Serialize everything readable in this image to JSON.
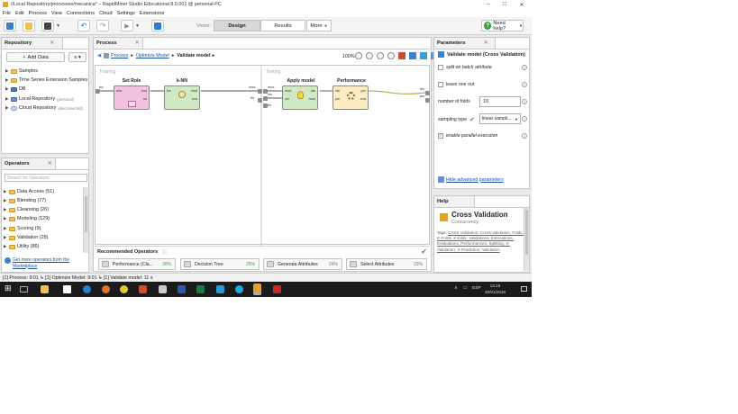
{
  "window": {
    "title": "//Local Repository/processes/mecanica* – RapidMiner Studio Educational 8.0.001 @ personal-PC",
    "min": "–",
    "max": "□",
    "close": "✕"
  },
  "menu": [
    "File",
    "Edit",
    "Process",
    "View",
    "Connections",
    "Cloud",
    "Settings",
    "Extensions"
  ],
  "toolbar": {
    "views_label": "Views:",
    "views": [
      "Design",
      "Results",
      "More"
    ],
    "help": "Need help?"
  },
  "repository": {
    "tab": "Repository",
    "add_data": "Add Data",
    "items": [
      {
        "label": "Samples",
        "suffix": ""
      },
      {
        "label": "Time Series Extension Samples",
        "suffix": ""
      },
      {
        "label": "DB",
        "suffix": ""
      },
      {
        "label": "Local Repository",
        "suffix": "(personal)"
      },
      {
        "label": "Cloud Repository",
        "suffix": "(disconnected)"
      }
    ]
  },
  "operators": {
    "tab": "Operators",
    "search_placeholder": "Search for Operators",
    "items": [
      "Data Access (51)",
      "Blending (77)",
      "Cleansing (26)",
      "Modeling (129)",
      "Scoring (9)",
      "Validation (28)",
      "Utility (86)"
    ],
    "marketplace": "Get more operators from the Marketplace"
  },
  "process": {
    "tab": "Process",
    "breadcrumb": [
      "Process",
      "Optimize Model",
      "Validate model"
    ],
    "zoom": "100%",
    "training_label": "Training",
    "testing_label": "Testing",
    "operators": {
      "set_role": "Set Role",
      "knn": "k-NN",
      "apply_model": "Apply model",
      "performance": "Performance"
    },
    "ports": {
      "tra": "tra",
      "exa": "exa",
      "ori": "ori",
      "mod": "mod",
      "lab": "lab",
      "unl": "unl",
      "per": "per",
      "tes": "tes",
      "thr": "thr"
    }
  },
  "recommended": {
    "title": "Recommended Operators",
    "items": [
      {
        "label": "Performance (Cla...",
        "pct": "30%"
      },
      {
        "label": "Decision Tree",
        "pct": "25%"
      },
      {
        "label": "Generate Attributes",
        "pct": "24%"
      },
      {
        "label": "Select Attributes",
        "pct": "23%"
      }
    ]
  },
  "parameters": {
    "tab": "Parameters",
    "header": "Validate model (Cross Validation)",
    "split_on_batch": "split on batch attribute",
    "leave_one_out": "leave one out",
    "folds_label": "number of folds",
    "folds_value": "10",
    "sampling_label": "sampling type",
    "sampling_value": "linear sampli...",
    "parallel": "enable parallel execution",
    "hide_advanced": "Hide advanced parameters"
  },
  "help_panel": {
    "tab": "Help",
    "title": "Cross Validation",
    "subtitle": "Concurrency",
    "tags_label": "Tags:",
    "tags": "Cross Validation, Cross-validation, Folds, K-Folds, K-folds, Validations, Estimations, Evaluations, Performances, Splitting, X-Validation, X-Prediction, Validation"
  },
  "status": "[1] Process: 9:01 ↳ [1] Optimize Model: 9:01 ↳ [1] Validate model: 11 s",
  "taskbar": {
    "lang": "ESP",
    "time": "13:18",
    "date": "30/01/2018"
  },
  "colors": {
    "accent_green": "#3d9c3d",
    "set_role_fill": "#f2c3e0",
    "knn_fill": "#cfe9c4",
    "apply_fill": "#cfe9c4",
    "perf_fill": "#fbecc2"
  }
}
